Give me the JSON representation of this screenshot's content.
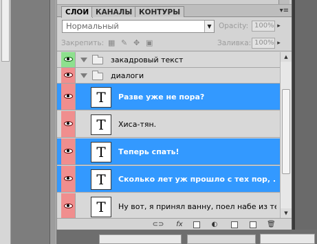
{
  "tabs": [
    {
      "label": "СЛОИ",
      "active": true
    },
    {
      "label": "КАНАЛЫ",
      "active": false
    },
    {
      "label": "КОНТУРЫ",
      "active": false
    }
  ],
  "tab_menu_glyph": "▾≡",
  "blend_mode": "Нормальный",
  "opacity": {
    "label": "Opacity:",
    "value": "100%"
  },
  "lock": {
    "label": "Закрепить:"
  },
  "fill": {
    "label": "Заливка:",
    "value": "100%"
  },
  "layers": [
    {
      "type": "group",
      "name": "закадровый текст",
      "eye_color": "green"
    },
    {
      "type": "group",
      "name": "диалоги",
      "eye_color": "red"
    },
    {
      "type": "text",
      "name": "Разве уже не пора?",
      "selected": true,
      "thumb": "T"
    },
    {
      "type": "text",
      "name": "Хиса-тян.",
      "selected": false,
      "thumb": "T"
    },
    {
      "type": "text",
      "name": "Теперь спать!",
      "selected": true,
      "thumb": "T"
    },
    {
      "type": "text",
      "name": "Сколько  лет уж прошло с тех пор, ...",
      "selected": true,
      "thumb": "T"
    },
    {
      "type": "text",
      "name": "Ну вот,  я принял ванну, поел набе из те...",
      "selected": false,
      "thumb": "T"
    }
  ],
  "colors": {
    "selection": "#3399ff",
    "eye_green": "#8ee08e",
    "eye_red": "#f08e8e"
  }
}
